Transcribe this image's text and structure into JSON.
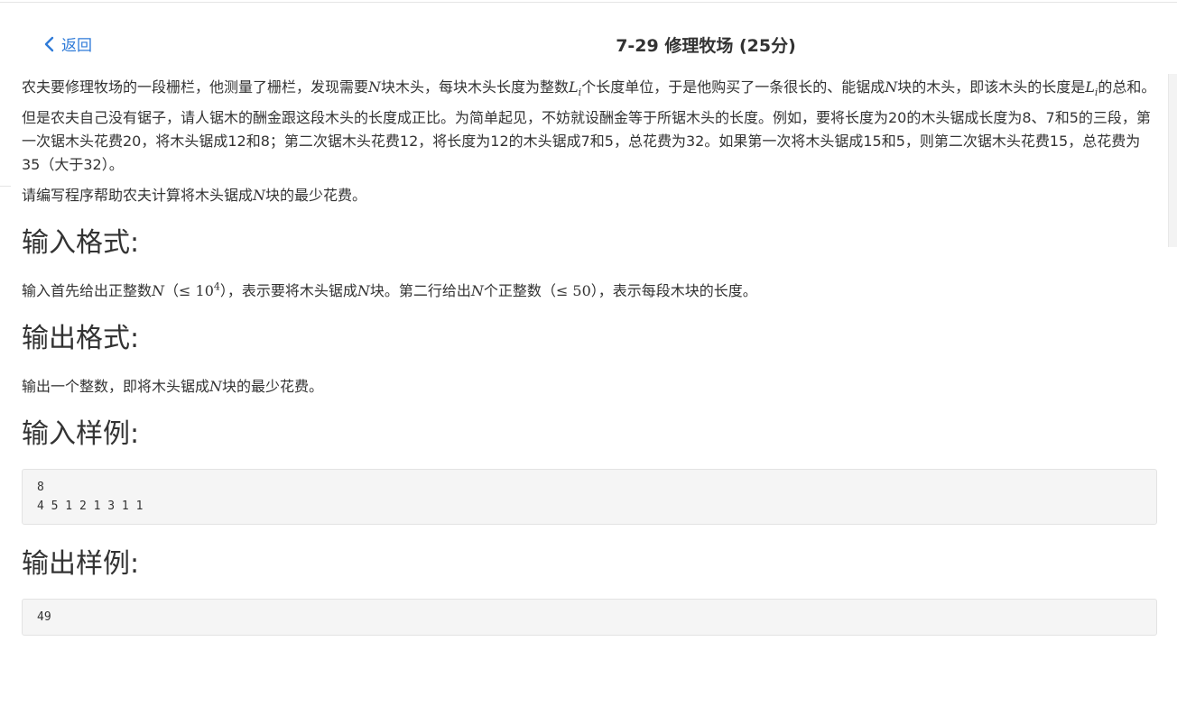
{
  "header": {
    "back_label": "返回",
    "title": "7-29 修理牧场 (25分)"
  },
  "statement": {
    "p1": {
      "a": "农夫要修理牧场的一段栅栏，他测量了栅栏，发现需要",
      "n1": "N",
      "b": "块木头，每块木头长度为整数",
      "l1": "L",
      "l1sub": "i",
      "c": "个长度单位，于是他购买了一条很长的、能锯成",
      "n2": "N",
      "d": "块的木头，即该木头的长度是",
      "l2": "L",
      "l2sub": "i",
      "e": "的总和。"
    },
    "p2": "但是农夫自己没有锯子，请人锯木的酬金跟这段木头的长度成正比。为简单起见，不妨就设酬金等于所锯木头的长度。例如，要将长度为20的木头锯成长度为8、7和5的三段，第一次锯木头花费20，将木头锯成12和8；第二次锯木头花费12，将长度为12的木头锯成7和5，总花费为32。如果第一次将木头锯成15和5，则第二次锯木头花费15，总花费为35（大于32）。",
    "p3": {
      "a": "请编写程序帮助农夫计算将木头锯成",
      "n": "N",
      "b": "块的最少花费。"
    }
  },
  "input_format": {
    "heading": "输入格式:",
    "a": "输入首先给出正整数",
    "n1": "N",
    "m1": "（≤ 10",
    "m1sup": "4",
    "m1end": "）",
    "b": "，表示要将木头锯成",
    "n2": "N",
    "c": "块。第二行给出",
    "n3": "N",
    "d": "个正整数",
    "m2": "（≤ 50）",
    "e": "，表示每段木块的长度。"
  },
  "output_format": {
    "heading": "输出格式:",
    "a": "输出一个整数，即将木头锯成",
    "n": "N",
    "b": "块的最少花费。"
  },
  "sample_input": {
    "heading": "输入样例:",
    "code": "8\n4 5 1 2 1 3 1 1"
  },
  "sample_output": {
    "heading": "输出样例:",
    "code": "49"
  }
}
